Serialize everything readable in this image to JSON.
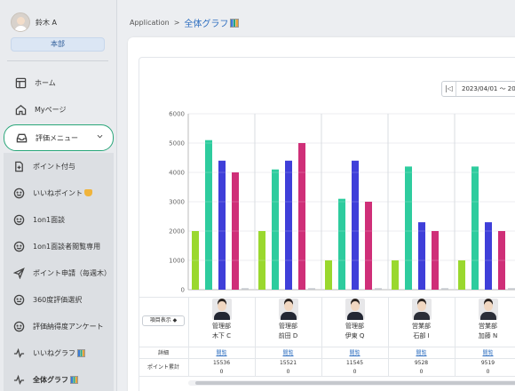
{
  "user": {
    "name": "鈴木 A",
    "department": "本部"
  },
  "nav": {
    "home": "ホーム",
    "mypage": "Myページ",
    "eval_menu": "評価メニュー",
    "sub": [
      "ポイント付与",
      "いいねポイント",
      "1on1面談",
      "1on1面談者閲覧専用",
      "ポイント申請（毎週木）",
      "360度評価選択",
      "評価納得度アンケート",
      "いいねグラフ",
      "全体グラフ"
    ]
  },
  "breadcrumb": {
    "root": "Application",
    "sep": ">",
    "current": "全体グラフ"
  },
  "date_range": {
    "text": "2023/04/01 ～ 20"
  },
  "table": {
    "column_toggle": "項目表示",
    "row_label_1": "詳細",
    "row_label_2": "ポイント累計",
    "detail_link": "閲覧",
    "people": [
      {
        "dept": "管理部",
        "name": "木下 C",
        "points": "15536",
        "zero": "0"
      },
      {
        "dept": "管理部",
        "name": "前田 D",
        "points": "15521",
        "zero": "0"
      },
      {
        "dept": "管理部",
        "name": "伊東 Q",
        "points": "11545",
        "zero": "0"
      },
      {
        "dept": "営業部",
        "name": "石部 I",
        "points": "9528",
        "zero": "0"
      },
      {
        "dept": "営業部",
        "name": "加藤 N",
        "points": "9519",
        "zero": "0"
      }
    ]
  },
  "chart_data": {
    "type": "bar",
    "ylim": [
      0,
      6000
    ],
    "yticks": [
      "0",
      "1000",
      "2000",
      "3000",
      "4000",
      "5000",
      "6000"
    ],
    "groups": 5,
    "series": [
      {
        "color": "#9ad82e",
        "values": [
          2000,
          2000,
          1000,
          1000,
          1000
        ]
      },
      {
        "color": "#2ecc9e",
        "values": [
          5100,
          4100,
          3100,
          4200,
          4200
        ]
      },
      {
        "color": "#3f3fd9",
        "values": [
          4400,
          4400,
          4400,
          2300,
          2300
        ]
      },
      {
        "color": "#cf2f78",
        "values": [
          4000,
          5000,
          3000,
          2000,
          2000
        ]
      }
    ]
  }
}
